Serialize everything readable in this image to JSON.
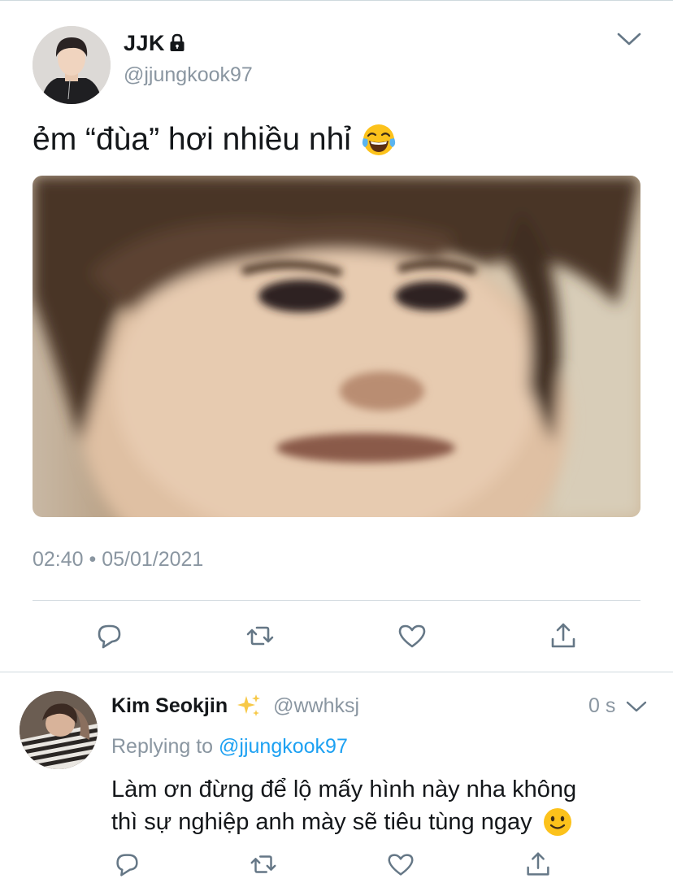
{
  "main_tweet": {
    "display_name": "JJK",
    "handle": "@jjungkook97",
    "text": "ẻm “đùa” hơi nhiều nhỉ",
    "timestamp": "02:40 • 05/01/2021",
    "icons": [
      "lock-icon",
      "chevron-down-icon",
      "reply-icon",
      "retweet-icon",
      "like-icon",
      "share-icon",
      "face-with-tears-of-joy-emoji"
    ]
  },
  "reply_tweet": {
    "display_name": "Kim Seokjin",
    "handle": "@wwhksj",
    "time": "0 s",
    "replying_prefix": "Replying to",
    "replying_handle": "@jjungkook97",
    "text_line1": "Làm ơn đừng để lộ mấy hình này nha không",
    "text_line2": "thì sự nghiệp anh mày sẽ tiêu tùng ngay",
    "icons": [
      "sparkles-icon",
      "chevron-down-icon",
      "reply-icon",
      "retweet-icon",
      "like-icon",
      "share-icon",
      "slightly-smiling-face-emoji"
    ]
  },
  "colors": {
    "text_primary": "#14171a",
    "text_secondary": "#8a96a1",
    "link": "#1da1f2",
    "icon": "#657786",
    "divider": "#d6dde2"
  }
}
